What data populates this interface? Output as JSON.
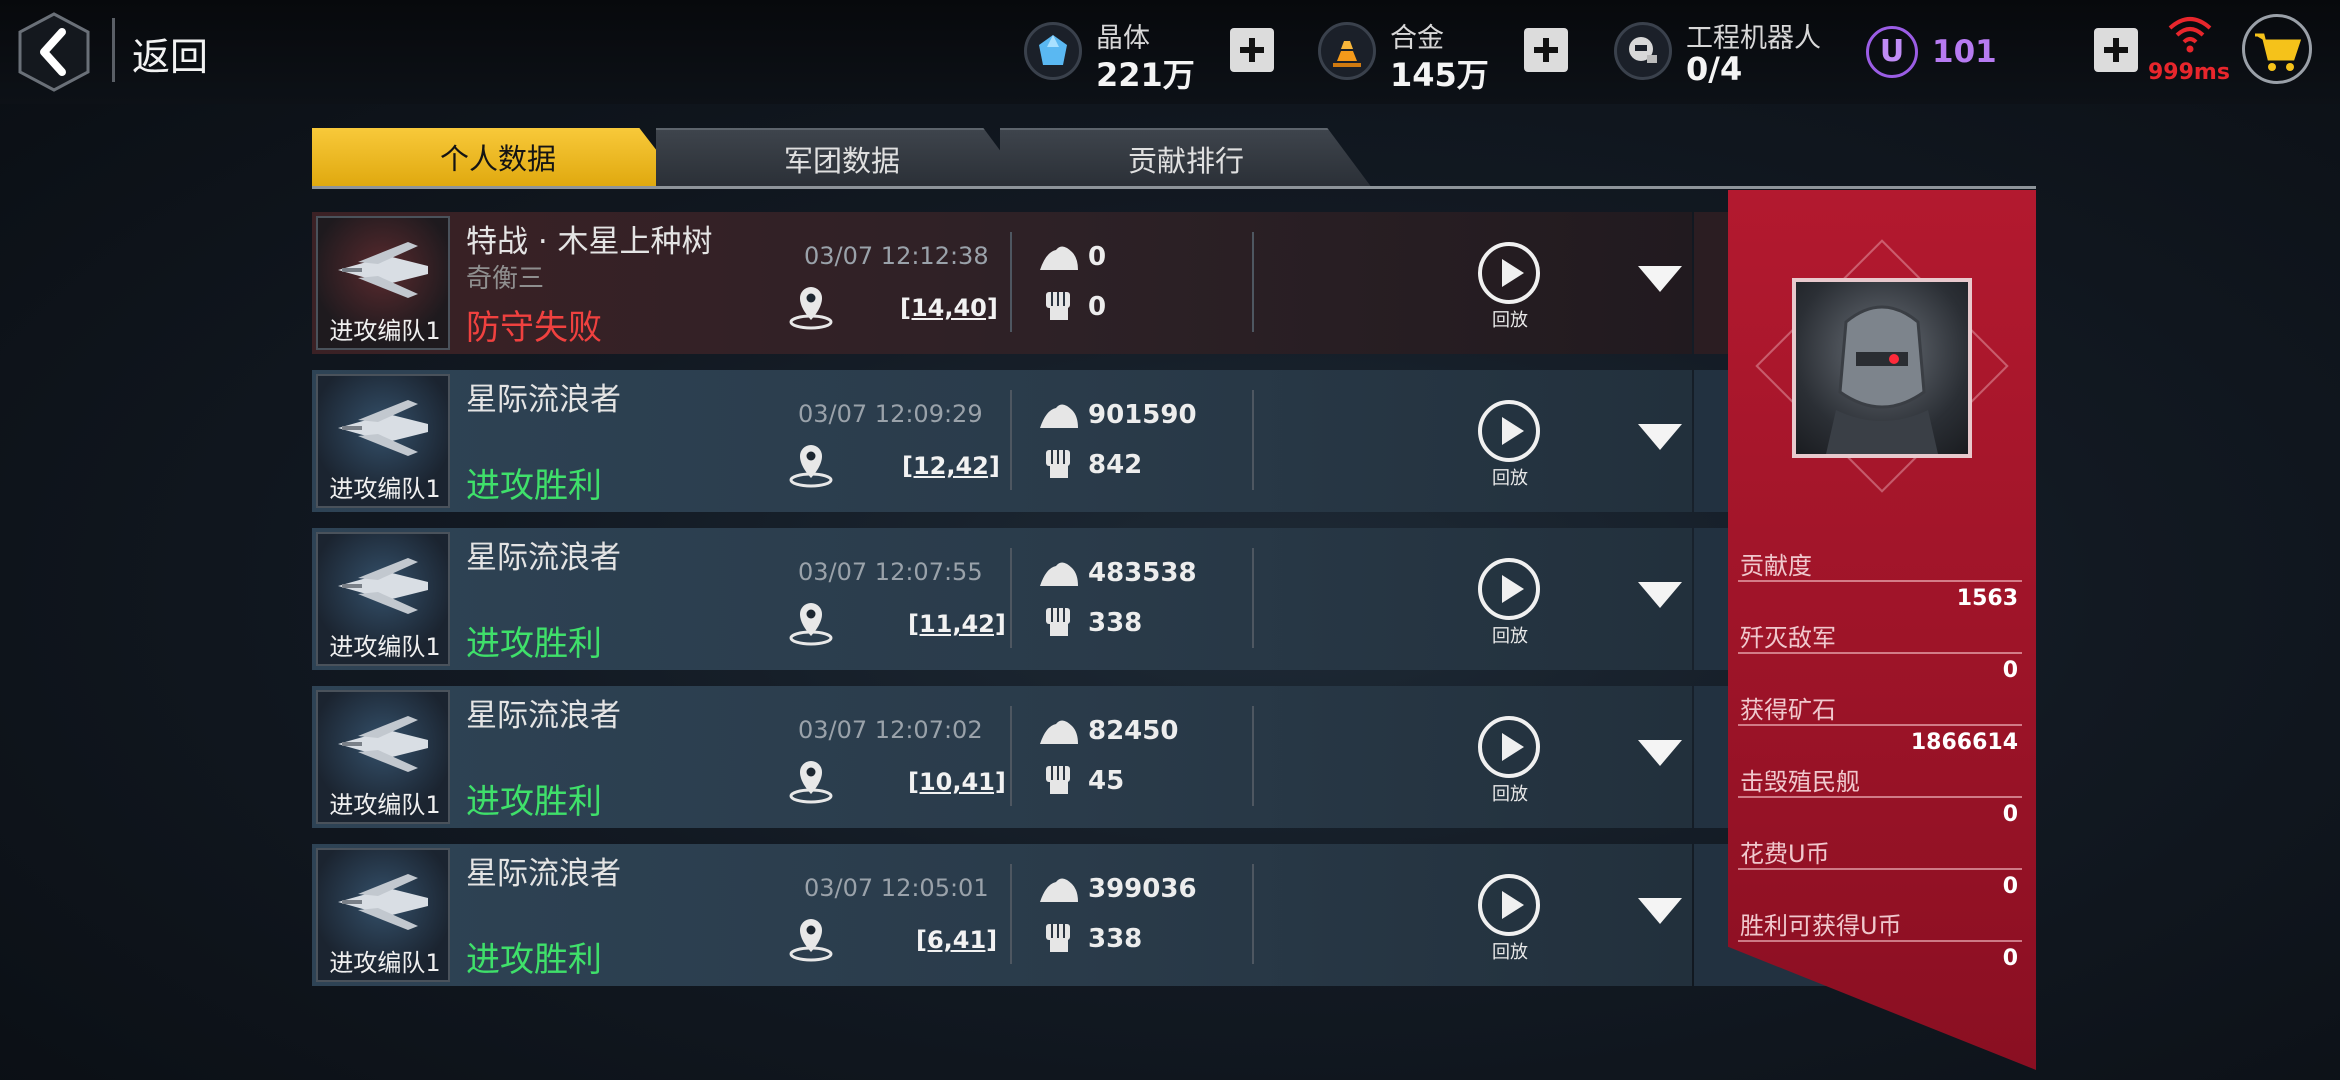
{
  "header": {
    "back_label": "返回",
    "resources": [
      {
        "name": "晶体",
        "value": "221万",
        "icon": "crystal-icon"
      },
      {
        "name": "合金",
        "value": "145万",
        "icon": "alloy-icon"
      },
      {
        "name": "工程机器人",
        "value": "0/4",
        "icon": "robot-icon"
      }
    ],
    "u_coin": {
      "symbol": "U",
      "value": "101"
    },
    "ping": "999ms"
  },
  "tabs": [
    {
      "label": "个人数据",
      "active": true
    },
    {
      "label": "军团数据",
      "active": false
    },
    {
      "label": "贡献排行",
      "active": false
    }
  ],
  "battles": [
    {
      "unit": "进攻编队1",
      "opponent": "特战 · 木星上种树",
      "sub": "奇衡三",
      "result": "防守失败",
      "won": false,
      "time": "03/07 12:12:38",
      "coord": "[14,40]",
      "ore": "0",
      "kills": "0",
      "replay": "回放"
    },
    {
      "unit": "进攻编队1",
      "opponent": "星际流浪者",
      "sub": "",
      "result": "进攻胜利",
      "won": true,
      "time": "03/07 12:09:29",
      "coord": "[12,42]",
      "ore": "901590",
      "kills": "842",
      "replay": "回放"
    },
    {
      "unit": "进攻编队1",
      "opponent": "星际流浪者",
      "sub": "",
      "result": "进攻胜利",
      "won": true,
      "time": "03/07 12:07:55",
      "coord": "[11,42]",
      "ore": "483538",
      "kills": "338",
      "replay": "回放"
    },
    {
      "unit": "进攻编队1",
      "opponent": "星际流浪者",
      "sub": "",
      "result": "进攻胜利",
      "won": true,
      "time": "03/07 12:07:02",
      "coord": "[10,41]",
      "ore": "82450",
      "kills": "45",
      "replay": "回放"
    },
    {
      "unit": "进攻编队1",
      "opponent": "星际流浪者",
      "sub": "",
      "result": "进攻胜利",
      "won": true,
      "time": "03/07 12:05:01",
      "coord": "[6,41]",
      "ore": "399036",
      "kills": "338",
      "replay": "回放"
    }
  ],
  "summary": [
    {
      "label": "贡献度",
      "value": "1563"
    },
    {
      "label": "歼灭敌军",
      "value": "0"
    },
    {
      "label": "获得矿石",
      "value": "1866614"
    },
    {
      "label": "击毁殖民舰",
      "value": "0"
    },
    {
      "label": "花费U币",
      "value": "0"
    },
    {
      "label": "胜利可获得U币",
      "value": "0"
    }
  ],
  "colors": {
    "accent_tab": "#f3c02a",
    "panel_red": "#a3142a",
    "win": "#3fe06a",
    "lose": "#f0413f",
    "u_purple": "#b77bf2"
  }
}
